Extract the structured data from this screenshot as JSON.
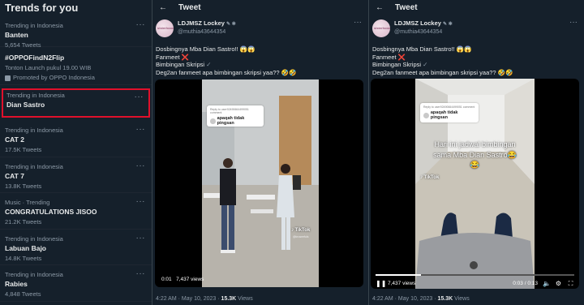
{
  "trends": {
    "header": "Trends for you",
    "items": [
      {
        "context": "",
        "name": "Banten",
        "count": "5,654 Tweets"
      },
      {
        "context": "",
        "name": "#OPPOFindN2Flip",
        "sub": "Tonton Launch pukul 19.00 WIB",
        "promoted": "Promoted by OPPO Indonesia"
      },
      {
        "context": "Trending in Indonesia",
        "name": "Dian Sastro",
        "count": ""
      },
      {
        "context": "Trending in Indonesia",
        "name": "CAT 2",
        "count": "17.5K Tweets"
      },
      {
        "context": "Trending in Indonesia",
        "name": "CAT 7",
        "count": "13.8K Tweets"
      },
      {
        "context": "Music · Trending",
        "name": "CONGRATULATIONS JISOO",
        "count": "21.2K Tweets"
      },
      {
        "context": "Trending in Indonesia",
        "name": "Labuan Bajo",
        "count": "14.8K Tweets"
      },
      {
        "context": "Trending in Indonesia",
        "name": "Rabies",
        "count": "4,848 Tweets"
      }
    ],
    "first_context": "Trending in Indonesia"
  },
  "tweet": {
    "title": "Tweet",
    "display_name": "LDJMSZ Lockey",
    "handle": "@muthia43644354",
    "lines": [
      "Dosbingnya Mba Dian Sastro!!",
      "Fanmeet",
      "Bimbingan Skripsi",
      "Deg2an fanmeet apa bimbingan skripsi yaa??"
    ],
    "emoji_1": "😱😱",
    "emoji_x": "❌",
    "emoji_check": "✓",
    "emoji_end": "🤣🤣",
    "avatar_text": "sisterhood",
    "meta_time": "4:22 AM · May 10, 2023 · ",
    "meta_views": "15.3K",
    "meta_views_label": " Views"
  },
  "video1": {
    "reply_top": "Reply to user92490664499051 comment",
    "reply_msg": "apaqah tidak pingsan",
    "tiktok": "TikTok",
    "tiktok_user": "@kruseefuls",
    "time": "0:01",
    "views": "7,437 views"
  },
  "video2": {
    "reply_top": "Reply to user92490664499051 comment",
    "reply_msg": "apaqah tidak pingsan",
    "overlay_text": "Hari ini jadwal bimbingan sama Mba Dian Sastro😂😂",
    "tiktok": "TikTok",
    "views": "7,437 views",
    "timer": "0:03 / 0:13",
    "progress": 0.23
  },
  "icons": [
    "back-arrow-icon",
    "more-icon",
    "verified-icon",
    "play-pause-icon",
    "volume-icon",
    "settings-icon",
    "fullscreen-icon",
    "promoted-icon"
  ],
  "colors": {
    "background": "#15202b",
    "highlight": "#e0102b",
    "muted": "#8b98a5"
  }
}
